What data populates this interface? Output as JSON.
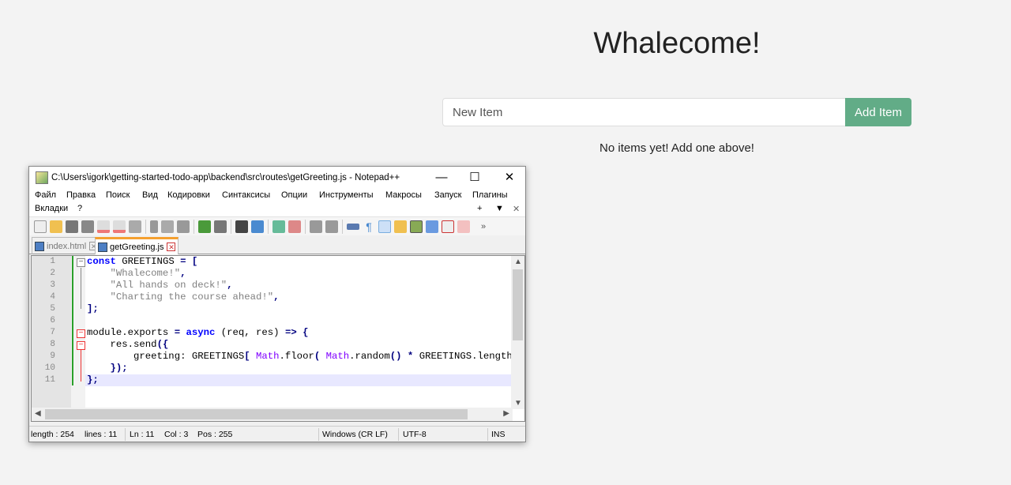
{
  "web": {
    "title": "Whalecome!",
    "input_placeholder": "New Item",
    "add_button": "Add Item",
    "empty_message": "No items yet! Add one above!"
  },
  "npp": {
    "title": "C:\\Users\\igork\\getting-started-todo-app\\backend\\src\\routes\\getGreeting.js - Notepad++",
    "window_controls": {
      "minimize": "—",
      "maximize": "☐",
      "close": "✕"
    },
    "menu": [
      "Файл",
      "Правка",
      "Поиск",
      "Вид",
      "Кодировки",
      "Синтаксисы",
      "Опции",
      "Инструменты",
      "Макросы",
      "Запуск",
      "Плагины",
      "Вкладки",
      "?"
    ],
    "menu_right": {
      "plus": "+",
      "down": "▼",
      "close": "✕"
    },
    "toolbar_more": "»",
    "tabs": [
      {
        "label": "index.html",
        "active": false
      },
      {
        "label": "getGreeting.js",
        "active": true
      }
    ],
    "line_numbers": [
      "1",
      "2",
      "3",
      "4",
      "5",
      "6",
      "7",
      "8",
      "9",
      "10",
      "11"
    ],
    "code": {
      "l1a": "const",
      "l1b": " GREETINGS ",
      "l1c": "= [",
      "l2": "    \"Whalecome!\"",
      "l2p": ",",
      "l3": "    \"All hands on deck!\"",
      "l3p": ",",
      "l4": "    \"Charting the course ahead!\"",
      "l4p": ",",
      "l5": "];",
      "l7a": "module.exports ",
      "l7b": "= ",
      "l7c": "async",
      "l7d": " (req, res) ",
      "l7e": "=> {",
      "l8a": "    res.send",
      "l8b": "({",
      "l9a": "        greeting: GREETINGS",
      "l9b": "[ ",
      "l9c": "Math",
      "l9d": ".floor",
      "l9e": "( ",
      "l9f": "Math",
      "l9g": ".random",
      "l9h": "() * ",
      "l9i": "GREETINGS.length",
      "l10": "    });",
      "l11": "};"
    },
    "status": {
      "length": "length : 254",
      "lines": "lines : 11",
      "ln": "Ln : 11",
      "col": "Col : 3",
      "pos": "Pos : 255",
      "eol": "Windows (CR LF)",
      "encoding": "UTF-8",
      "mode": "INS"
    }
  }
}
